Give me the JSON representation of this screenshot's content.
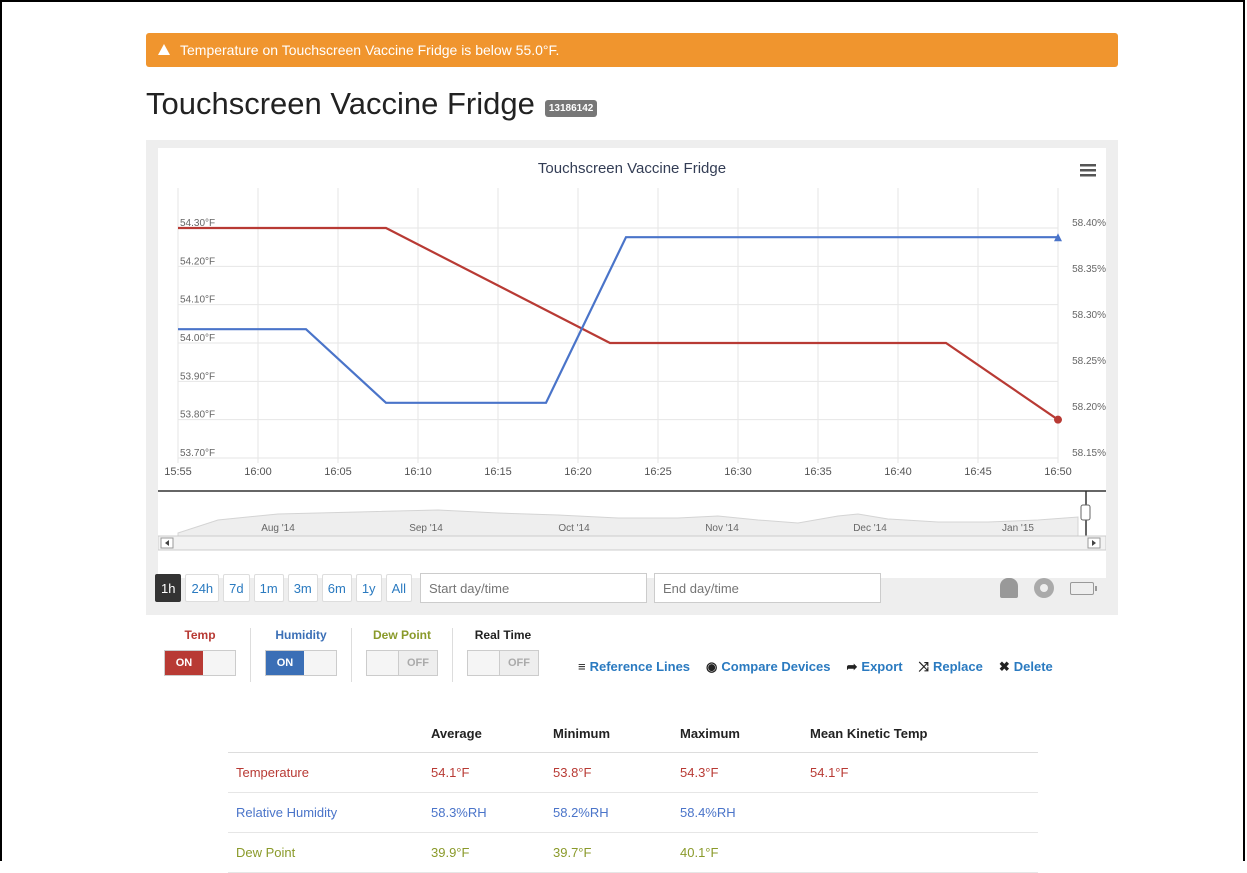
{
  "alert": {
    "text": "Temperature on Touchscreen Vaccine Fridge is below 55.0°F."
  },
  "device": {
    "name": "Touchscreen Vaccine Fridge",
    "id_badge": "13186142"
  },
  "chart_data": {
    "type": "line",
    "title": "Touchscreen Vaccine Fridge",
    "x": [
      "15:55",
      "16:00",
      "16:05",
      "16:10",
      "16:15",
      "16:20",
      "16:25",
      "16:30",
      "16:35",
      "16:40",
      "16:45",
      "16:50"
    ],
    "y_left_ticks": [
      "53.70°F",
      "53.80°F",
      "53.90°F",
      "54.00°F",
      "54.10°F",
      "54.20°F",
      "54.30°F"
    ],
    "y_right_ticks": [
      "58.15%",
      "58.20%",
      "58.25%",
      "58.30%",
      "58.35%",
      "58.40%"
    ],
    "ylim_left": [
      53.7,
      54.3
    ],
    "ylim_right": [
      58.15,
      58.4
    ],
    "series": [
      {
        "name": "Temp",
        "axis": "left",
        "color": "#b83a34",
        "points": [
          [
            "15:55",
            54.3
          ],
          [
            "16:08",
            54.3
          ],
          [
            "16:22",
            54.0
          ],
          [
            "16:43",
            54.0
          ],
          [
            "16:50",
            53.8
          ]
        ]
      },
      {
        "name": "Humidity",
        "axis": "right",
        "color": "#4a74c9",
        "points": [
          [
            "15:55",
            58.29
          ],
          [
            "16:03",
            58.29
          ],
          [
            "16:08",
            58.21
          ],
          [
            "16:18",
            58.21
          ],
          [
            "16:23",
            58.39
          ],
          [
            "16:50",
            58.39
          ]
        ]
      }
    ],
    "navigator_labels": [
      "Aug '14",
      "Sep '14",
      "Oct '14",
      "Nov '14",
      "Dec '14",
      "Jan '15"
    ]
  },
  "ranges": [
    "1h",
    "24h",
    "7d",
    "1m",
    "3m",
    "6m",
    "1y",
    "All"
  ],
  "start_placeholder": "Start day/time",
  "end_placeholder": "End day/time",
  "toggles": [
    {
      "label": "Temp",
      "state": "ON",
      "color": "#b83a34"
    },
    {
      "label": "Humidity",
      "state": "ON",
      "color": "#3b6fb6"
    },
    {
      "label": "Dew Point",
      "state": "OFF",
      "color": "#8a9a2a"
    },
    {
      "label": "Real Time",
      "state": "OFF",
      "color": "#222222"
    }
  ],
  "actions": {
    "reference_lines": "Reference Lines",
    "compare_devices": "Compare Devices",
    "export": "Export",
    "replace": "Replace",
    "delete": "Delete"
  },
  "stats": {
    "headers": [
      "",
      "Average",
      "Minimum",
      "Maximum",
      "Mean Kinetic Temp"
    ],
    "rows": [
      {
        "label": "Temperature",
        "avg": "54.1°F",
        "min": "53.8°F",
        "max": "54.3°F",
        "mkt": "54.1°F",
        "color": "#b83a34"
      },
      {
        "label": "Relative Humidity",
        "avg": "58.3%RH",
        "min": "58.2%RH",
        "max": "58.4%RH",
        "mkt": "",
        "color": "#4a74c9"
      },
      {
        "label": "Dew Point",
        "avg": "39.9°F",
        "min": "39.7°F",
        "max": "40.1°F",
        "mkt": "",
        "color": "#8a9a2a"
      }
    ]
  }
}
